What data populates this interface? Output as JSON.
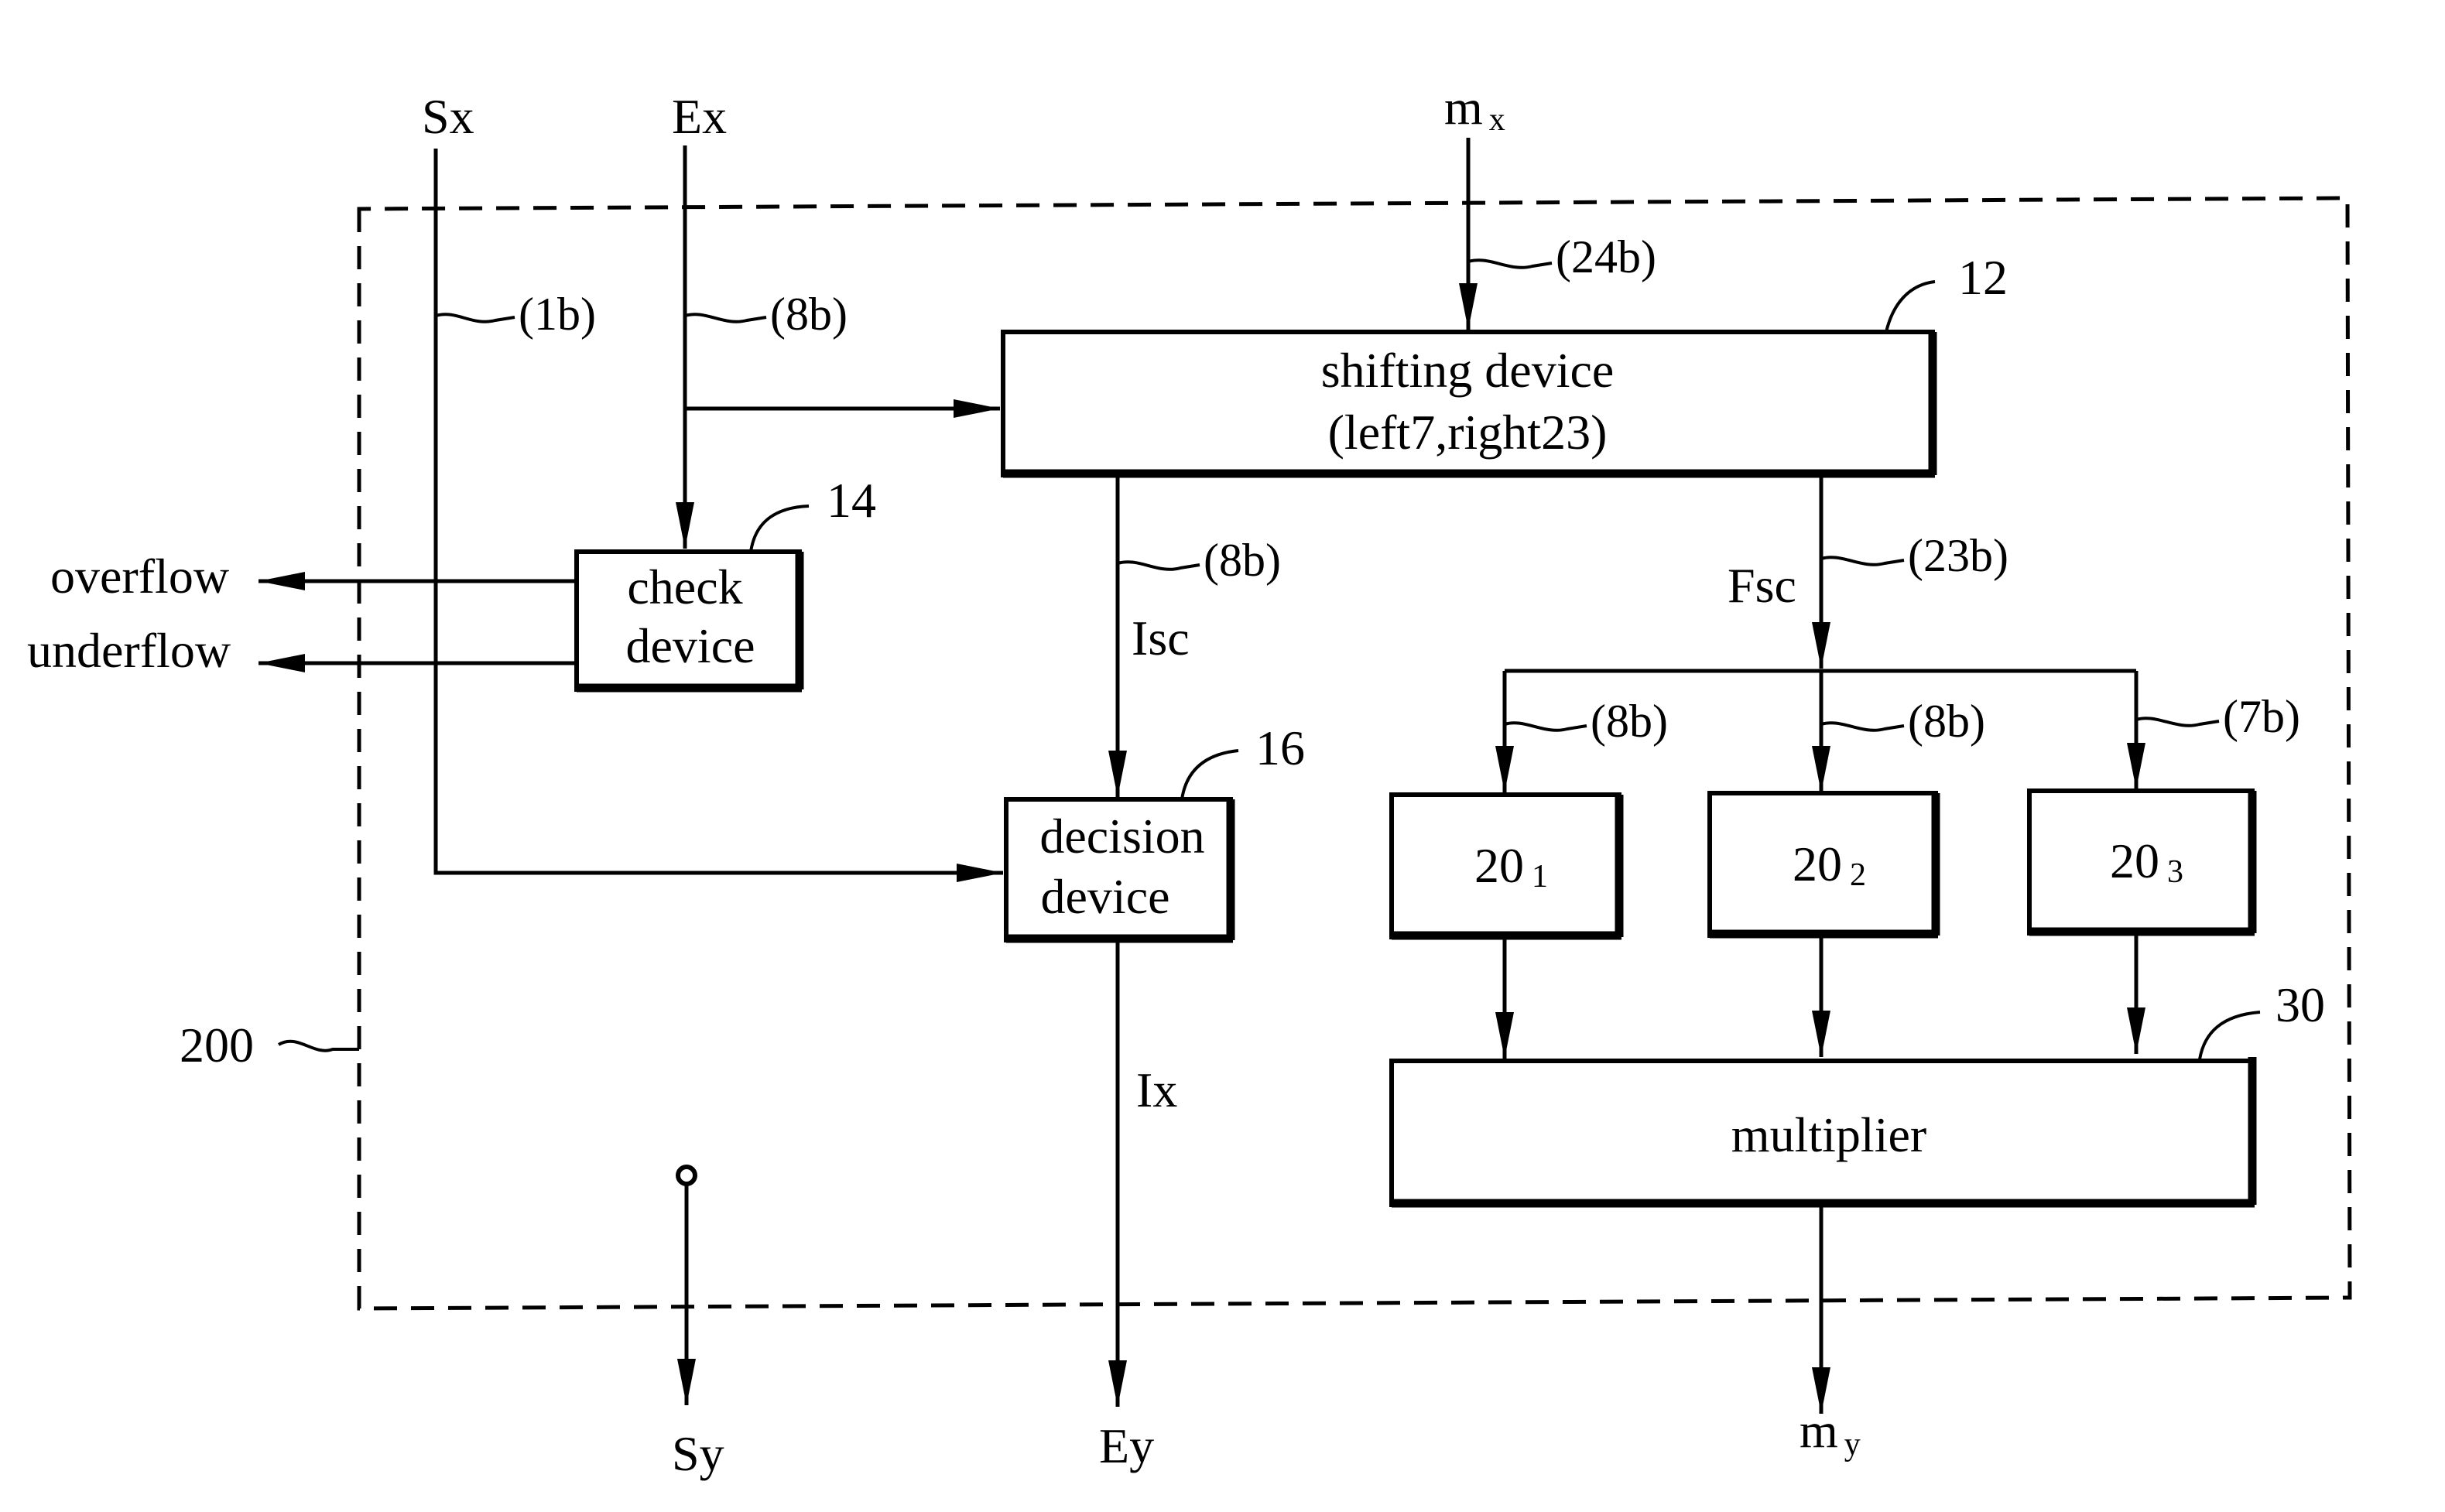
{
  "figure": {
    "type": "block-diagram",
    "enclosure": {
      "ref": "200"
    },
    "inputs": {
      "sign_in": "Sx",
      "exponent_in": "Ex",
      "mantissa_in": {
        "base": "m",
        "sub": "x"
      }
    },
    "outputs": {
      "sign_out": "Sy",
      "exponent_out": "Ey",
      "mantissa_out": {
        "base": "m",
        "sub": "y"
      },
      "overflow": "overflow",
      "underflow": "underflow"
    },
    "wire_widths": {
      "sx": "(1b)",
      "ex": "(8b)",
      "mx": "(24b)",
      "isc": "(8b)",
      "fsc": "(23b)",
      "branch1": "(8b)",
      "branch2": "(8b)",
      "branch3": "(7b)"
    },
    "signals": {
      "isc": "Isc",
      "fsc": "Fsc",
      "ix": "Ix"
    },
    "blocks": {
      "shifting": {
        "ref": "12",
        "line1": "shifting device",
        "line2": "(left7,right23)"
      },
      "check": {
        "ref": "14",
        "line1": "check",
        "line2": "device"
      },
      "decision": {
        "ref": "16",
        "line1": "decision",
        "line2": "device"
      },
      "lut1": {
        "base": "20",
        "sub": "1"
      },
      "lut2": {
        "base": "20",
        "sub": "2"
      },
      "lut3": {
        "base": "20",
        "sub": "3"
      },
      "multiplier": {
        "ref": "30",
        "label": "multiplier"
      }
    }
  }
}
